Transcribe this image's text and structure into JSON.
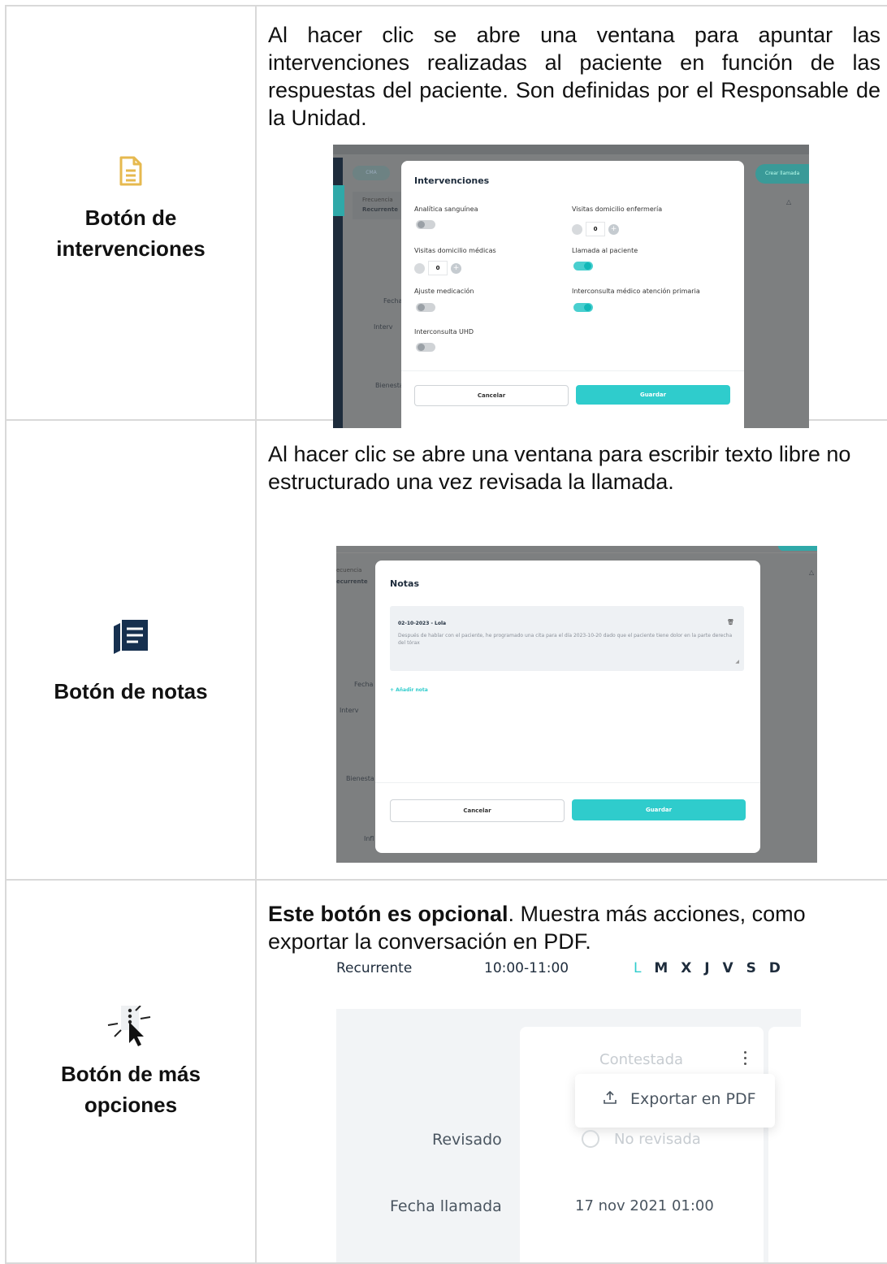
{
  "rows": [
    {
      "label": "Botón de intervenciones",
      "icon": "document-icon",
      "description": "Al hacer clic se abre una ventana para apuntar las intervenciones realizadas al paciente en función de las respuestas del paciente. Son definidas por el Responsable de la Unidad.",
      "screenshot": {
        "bg": {
          "pill": "CMA",
          "call_button": "Crear llamada",
          "freq_label": "Frecuencia",
          "freq_value": "Recurrente",
          "fecha": "Fecha",
          "interv": "Interv",
          "bienesta": "Bienesta"
        },
        "title": "Intervenciones",
        "fields": [
          {
            "label": "Analítica sanguínea",
            "type": "toggle",
            "on": false
          },
          {
            "label": "Visitas domicilio enfermería",
            "type": "stepper",
            "value": "0"
          },
          {
            "label": "Visitas domicilio médicas",
            "type": "stepper",
            "value": "0"
          },
          {
            "label": "Llamada al paciente",
            "type": "toggle",
            "on": true
          },
          {
            "label": "Ajuste medicación",
            "type": "toggle",
            "on": false
          },
          {
            "label": "Interconsulta médico atención primaria",
            "type": "toggle",
            "on": true
          },
          {
            "label": "Interconsulta UHD",
            "type": "toggle",
            "on": false
          }
        ],
        "cancel": "Cancelar",
        "save": "Guardar"
      }
    },
    {
      "label": "Botón de notas",
      "icon": "notes-icon",
      "description": "Al hacer clic se abre una ventana para escribir texto libre no estructurado una vez revisada la llamada.",
      "screenshot": {
        "bg": {
          "freq_label": "ecuencia",
          "freq_value": "ecurrente",
          "fecha": "Fecha",
          "interv": "Interv",
          "bienesta": "Bienesta",
          "infl": "Infl"
        },
        "title": "Notas",
        "note_header": "02-10-2023 - Lola",
        "note_text": "Después de hablar con el paciente, he programado una cita para el día 2023-10-20 dado que el paciente tiene dolor en la parte derecha del tórax",
        "add_note": "+ Añadir nota",
        "cancel": "Cancelar",
        "save": "Guardar"
      }
    },
    {
      "label": "Botón de más opciones",
      "icon": "more-options-icon",
      "description_bold": "Este botón es opcional",
      "description_rest": ". Muestra más acciones, como exportar la conversación en PDF.",
      "screenshot": {
        "top": {
          "freq": "Recurrente",
          "time": "10:00-11:00",
          "days": [
            "L",
            "M",
            "X",
            "J",
            "V",
            "S",
            "D"
          ]
        },
        "status": "Contestada",
        "menu_item": "Exportar en PDF",
        "revisado_label": "Revisado",
        "revisado_value": "No revisada",
        "fecha_label": "Fecha llamada",
        "fecha_value": "17 nov 2021 01:00"
      }
    }
  ]
}
